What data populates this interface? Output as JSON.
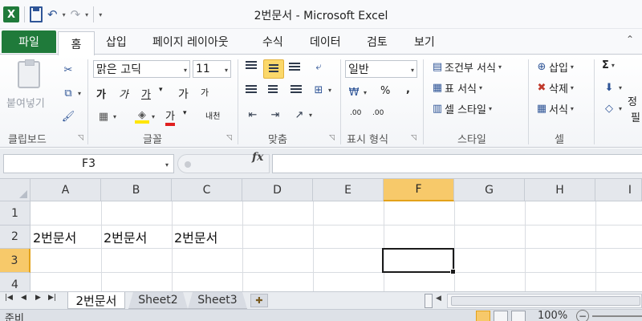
{
  "window": {
    "title": "2번문서  -  Microsoft Excel",
    "app_icon_label": "X",
    "qat": {
      "undo": "↶",
      "redo": "↷",
      "customize": "▾"
    }
  },
  "tabs": {
    "file": "파일",
    "items": [
      "홈",
      "삽입",
      "페이지 레이아웃",
      "수식",
      "데이터",
      "검토",
      "보기"
    ],
    "active": "홈"
  },
  "ribbon": {
    "clipboard": {
      "paste_label": "붙여넣기",
      "group_label": "클립보드"
    },
    "font": {
      "group_label": "글꼴",
      "font_name": "맑은 고딕",
      "font_size": "11",
      "bold": "가",
      "italic": "가",
      "underline": "가",
      "grow": "가",
      "shrink": "가",
      "font_color": "가",
      "phonetic": "내천"
    },
    "alignment": {
      "group_label": "맞춤"
    },
    "number": {
      "group_label": "표시 형식",
      "format": "일반",
      "percent": "%",
      "comma": ",",
      "inc_decimal": ".00",
      "dec_decimal": ".00"
    },
    "styles": {
      "group_label": "스타일",
      "conditional": "조건부 서식",
      "table": "표 서식",
      "cell": "셀 스타일"
    },
    "cells": {
      "group_label": "셀",
      "insert": "삽입",
      "delete": "삭제",
      "format": "서식"
    },
    "editing": {
      "sum": "Σ",
      "sort": "정",
      "find": "필"
    }
  },
  "formula_bar": {
    "name_box": "F3",
    "fx": "fx",
    "content": ""
  },
  "grid": {
    "columns": [
      "A",
      "B",
      "C",
      "D",
      "E",
      "F",
      "G",
      "H",
      "I"
    ],
    "rows": [
      "1",
      "2",
      "3",
      "4"
    ],
    "selected_column": "F",
    "selected_row": "3",
    "cells": {
      "A2": "2번문서",
      "B2": "2번문서",
      "C2": "2번문서"
    }
  },
  "sheets": {
    "tabs": [
      "2번문서",
      "Sheet2",
      "Sheet3"
    ],
    "active": "2번문서"
  },
  "status": {
    "text": "준비",
    "zoom": "100%",
    "zoom_minus": "−"
  },
  "colors": {
    "accent_green": "#1f7a3a",
    "selection_highlight": "#f7c96a"
  }
}
